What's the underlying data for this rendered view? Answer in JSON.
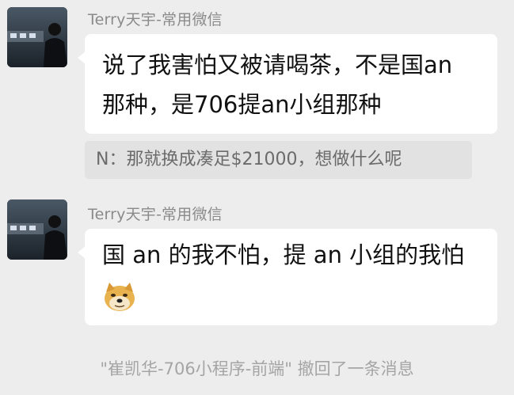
{
  "messages": [
    {
      "sender": "Terry天宇-常用微信",
      "lines": [
        "说了我害怕又被请喝茶，不是国an",
        "那种，是706提an小组那种"
      ],
      "quote": "N：那就换成凑足$21000，想做什么呢"
    },
    {
      "sender": "Terry天宇-常用微信",
      "lines": [
        "国 an 的我不怕，提 an 小组的我怕"
      ],
      "emoji": "doge-emoji"
    }
  ],
  "system_notice": "\"崔凯华-706小程序-前端\" 撤回了一条消息"
}
